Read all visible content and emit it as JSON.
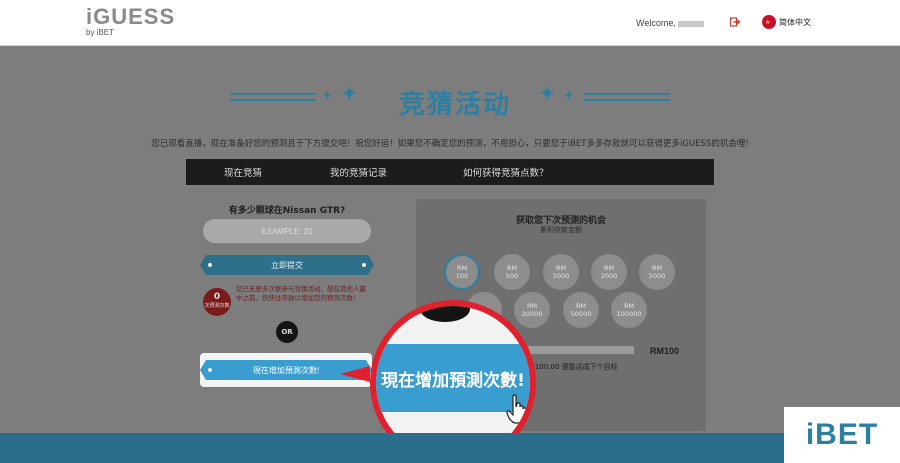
{
  "header": {
    "logo_main": "iGUESS",
    "logo_sub": "by iBET",
    "welcome": "Welcome,",
    "language": "简体中文"
  },
  "page": {
    "title": "竞猜活动",
    "intro": "您已观看直播，现在准备好您的预测且于下方提交吧！祝您好运！如果您不确定您的预测，不用担心，只要您于iBET多多存款就可以获得更多iGUESS的机会哩!"
  },
  "tabs": [
    {
      "label": "现在竞猜"
    },
    {
      "label": "我的竞猜记录"
    },
    {
      "label": "如何获得竞猜点数？"
    }
  ],
  "guess": {
    "question": "有多少颗球在Nissan GTR?",
    "placeholder": "EXAMPLE: 20",
    "submit_label": "立即提交",
    "badge_count": "0",
    "badge_text": "次预测次数",
    "badge_note": "您已无更多次数参与竞猜活动，想在其他人赢中之前，快快往存款以增加您的预测次数!",
    "or_label": "OR",
    "add_label": "現在增加預測次數!"
  },
  "panel": {
    "title": "获取您下次预测的机会",
    "subtitle": "累积存款金额",
    "amounts_row1": [
      {
        "currency": "RM",
        "value": "100"
      },
      {
        "currency": "RM",
        "value": "500"
      },
      {
        "currency": "RM",
        "value": "1000"
      },
      {
        "currency": "RM",
        "value": "2000"
      },
      {
        "currency": "RM",
        "value": "5000"
      }
    ],
    "amounts_row2": [
      {
        "currency": "RM",
        "value": ""
      },
      {
        "currency": "RM",
        "value": "20000"
      },
      {
        "currency": "RM",
        "value": "50000"
      },
      {
        "currency": "RM",
        "value": "100000"
      }
    ],
    "progress_value": "RM100",
    "progress_note": "RM100.00 便能达成下个目标"
  },
  "zoom": {
    "label": "現在增加預測次數!"
  },
  "watermark": {
    "text": "iBET"
  },
  "colors": {
    "accent": "#2c7fa3",
    "button_blue": "#3a9dd0",
    "callout_red": "#e0202c",
    "tab_bar": "#1c1c1c"
  }
}
